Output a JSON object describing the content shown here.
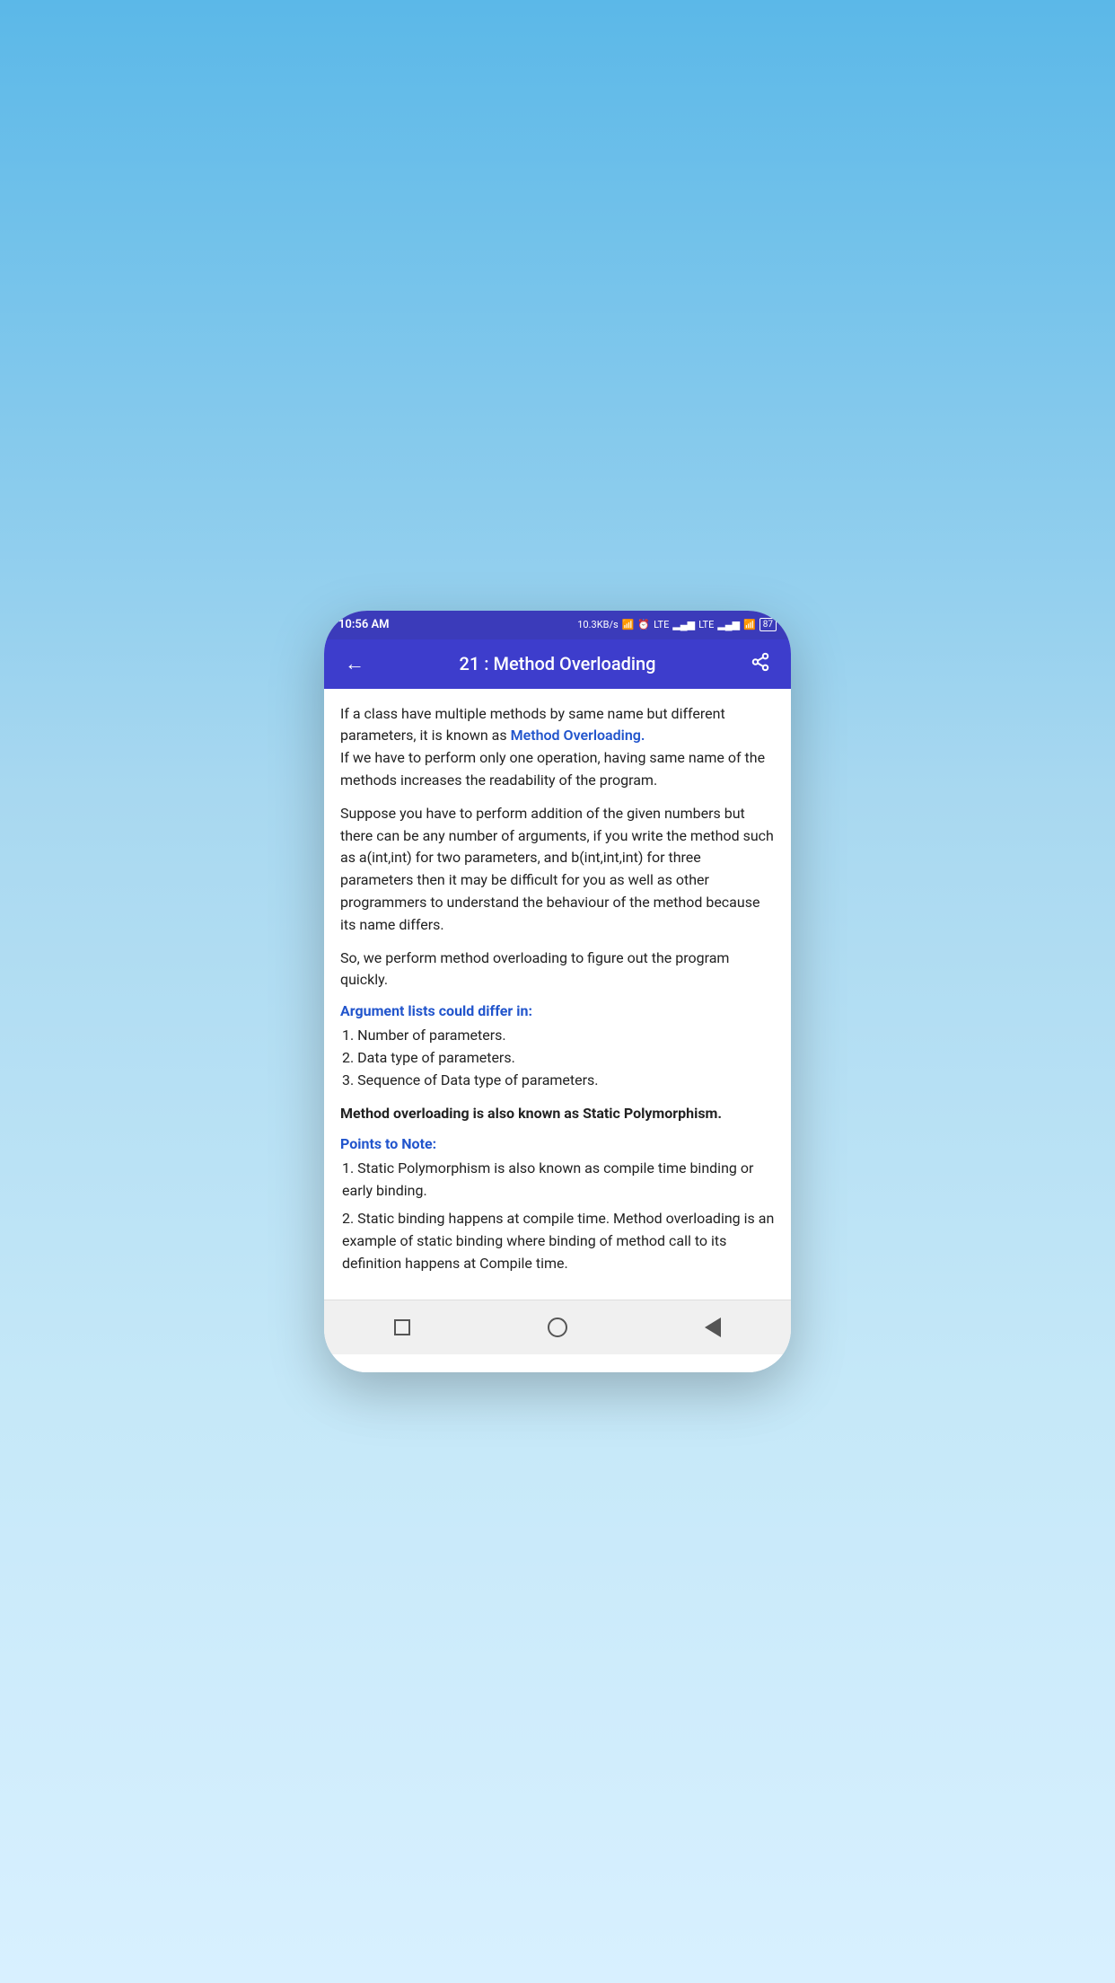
{
  "status_bar": {
    "time": "10:56 AM",
    "network_speed": "10.3KB/s",
    "battery": "87"
  },
  "header": {
    "title": "21 :  Method Overloading",
    "back_label": "←",
    "share_label": "⋮"
  },
  "content": {
    "paragraph1_normal": "If a class have multiple methods by same name but different parameters, it is known as ",
    "paragraph1_highlight": "Method Overloading.",
    "paragraph1_end": "If we have to perform only one operation, having same name of the methods increases the readability of the program.",
    "paragraph2": "Suppose you have to perform addition of the given numbers but there can be any number of arguments, if you write the method such as a(int,int) for two parameters, and b(int,int,int) for three parameters then it may be difficult for you as well as other programmers to understand the behaviour of the method because its name differs.",
    "paragraph3": "So, we perform method overloading to figure out the program quickly.",
    "section1_heading": "Argument lists could differ in:",
    "section1_list": [
      "1. Number of parameters.",
      "2. Data type of parameters.",
      "3. Sequence of Data type of parameters."
    ],
    "bold_statement": "Method overloading is also known as Static Polymorphism.",
    "section2_heading": "Points to Note:",
    "section2_list": [
      "1. Static Polymorphism is also known as compile time binding or early binding.",
      "2. Static binding happens at compile time. Method overloading is an example of static binding where binding of method call to its definition happens at Compile time."
    ]
  },
  "nav_bar": {
    "square_label": "recent-apps",
    "circle_label": "home",
    "back_label": "back"
  }
}
